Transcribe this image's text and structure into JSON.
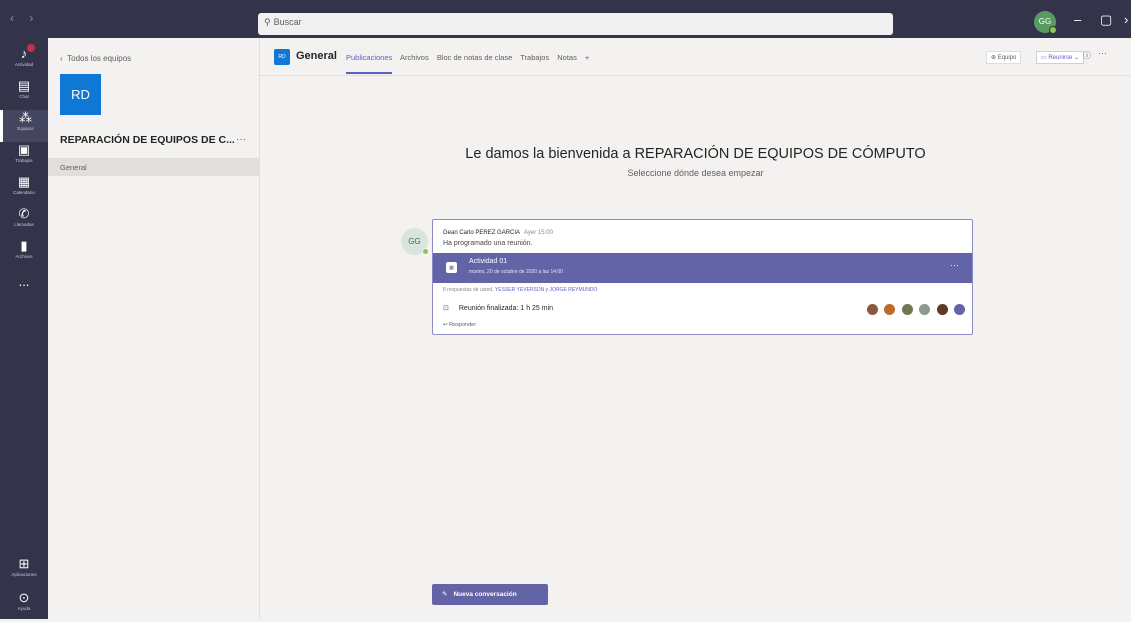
{
  "search": {
    "placeholder": "Buscar",
    "icon": "search-icon"
  },
  "user": {
    "initials": "GG"
  },
  "rail": [
    {
      "label": "Actividad",
      "icon": "bell-icon"
    },
    {
      "label": "Chat",
      "icon": "chat-icon"
    },
    {
      "label": "Equipos",
      "icon": "teams-icon"
    },
    {
      "label": "Trabajos",
      "icon": "assignments-icon"
    },
    {
      "label": "Calendario",
      "icon": "calendar-icon"
    },
    {
      "label": "Llamadas",
      "icon": "phone-icon"
    },
    {
      "label": "Archivos",
      "icon": "files-icon"
    },
    {
      "label": "...",
      "icon": "more-icon"
    },
    {
      "label": "Aplicaciones",
      "icon": "apps-icon"
    },
    {
      "label": "Ayuda",
      "icon": "help-icon"
    }
  ],
  "team": {
    "back_label": "Todos los equipos",
    "avatar": "RD",
    "name": "REPARACIÓN DE EQUIPOS DE C...",
    "more": "···",
    "channels": [
      "General"
    ]
  },
  "channel": {
    "avatar": "RD",
    "title": "General",
    "tabs": [
      "Publicaciones",
      "Archivos",
      "Bloc de notas de clase",
      "Trabajos",
      "Notas",
      "+"
    ],
    "equipo_label": "Equipo",
    "reunirse_label": "Reunirse",
    "more": "···"
  },
  "welcome": {
    "title": "Le damos la bienvenida a REPARACIÓN DE EQUIPOS DE CÓMPUTO",
    "subtitle": "Seleccione dónde desea empezar"
  },
  "post": {
    "avatar": "GG",
    "author": "Gean Carlo PEREZ GARCIA",
    "time": "Ayer 15:00",
    "text": "Ha programado una reunión.",
    "meeting_title": "Actividad 01",
    "meeting_date": "martes, 20 de octubre de 2020 a las 14:00",
    "meeting_more": "···",
    "replies_prefix": "8 respuestas de usted,",
    "replies_names": "YESSER YEVERSON y JORGE REYMUNDO",
    "ended": "Reunión finalizada: 1 h 25 min",
    "reply_label": "Responder"
  },
  "new_conversation": "Nueva conversación",
  "colors": {
    "rail": "#33344a",
    "accent": "#6264a7",
    "team_avatar": "#0f78d4"
  }
}
